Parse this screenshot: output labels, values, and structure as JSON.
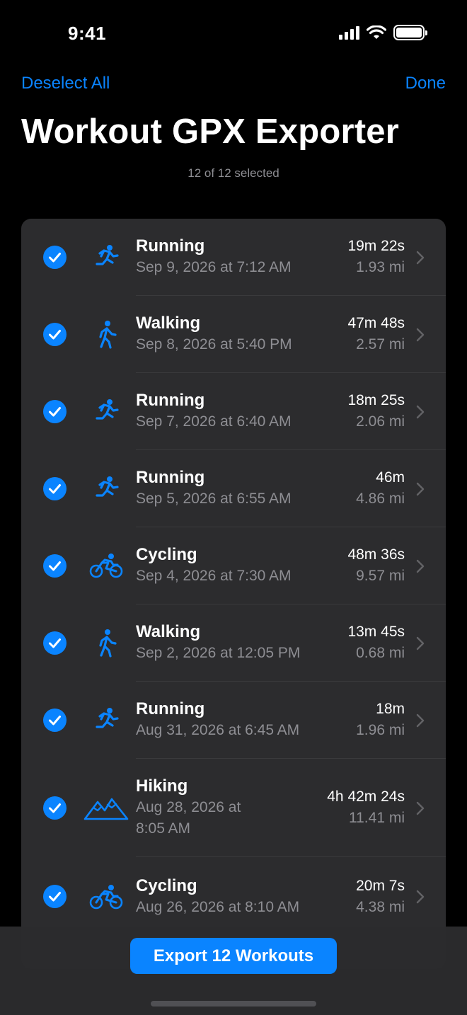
{
  "status_bar": {
    "time": "9:41"
  },
  "nav": {
    "left_label": "Deselect All",
    "right_label": "Done"
  },
  "page": {
    "title": "Workout GPX Exporter",
    "subtitle": "12 of 12 selected"
  },
  "accent_color": "#0a84ff",
  "workouts": [
    {
      "name": "Running",
      "date": "Sep 9, 2026 at 7:12 AM",
      "duration": "19m 22s",
      "distance": "1.93 mi",
      "icon": "running-icon",
      "selected": true
    },
    {
      "name": "Walking",
      "date": "Sep 8, 2026 at 5:40 PM",
      "duration": "47m 48s",
      "distance": "2.57 mi",
      "icon": "walking-icon",
      "selected": true
    },
    {
      "name": "Running",
      "date": "Sep 7, 2026 at 6:40 AM",
      "duration": "18m 25s",
      "distance": "2.06 mi",
      "icon": "running-icon",
      "selected": true
    },
    {
      "name": "Running",
      "date": "Sep 5, 2026 at 6:55 AM",
      "duration": "46m",
      "distance": "4.86 mi",
      "icon": "running-icon",
      "selected": true
    },
    {
      "name": "Cycling",
      "date": "Sep 4, 2026 at 7:30 AM",
      "duration": "48m 36s",
      "distance": "9.57 mi",
      "icon": "cycling-icon",
      "selected": true
    },
    {
      "name": "Walking",
      "date": "Sep 2, 2026 at 12:05 PM",
      "duration": "13m 45s",
      "distance": "0.68 mi",
      "icon": "walking-icon",
      "selected": true
    },
    {
      "name": "Running",
      "date": "Aug 31, 2026 at 6:45 AM",
      "duration": "18m",
      "distance": "1.96 mi",
      "icon": "running-icon",
      "selected": true
    },
    {
      "name": "Hiking",
      "date": "Aug 28, 2026 at",
      "date_line2": "8:05 AM",
      "duration": "4h 42m 24s",
      "distance": "11.41 mi",
      "icon": "hiking-icon",
      "selected": true
    },
    {
      "name": "Cycling",
      "date": "Aug 26, 2026 at 8:10 AM",
      "duration": "20m 7s",
      "distance": "4.38 mi",
      "icon": "cycling-icon",
      "selected": true
    }
  ],
  "export": {
    "label": "Export 12 Workouts"
  }
}
